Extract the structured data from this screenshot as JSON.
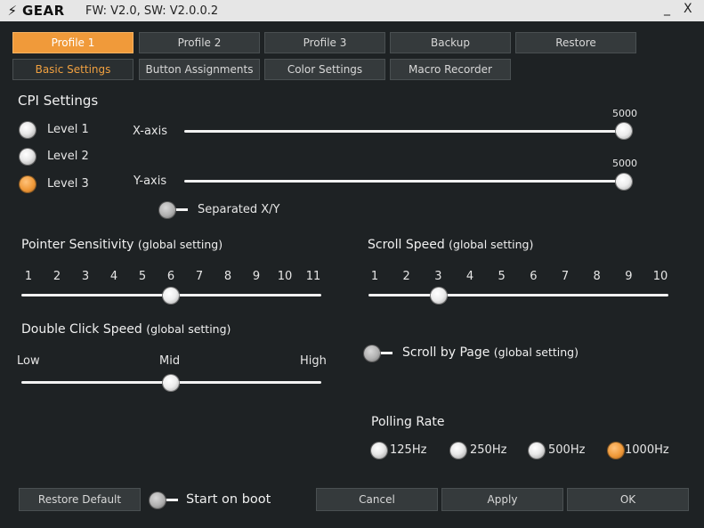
{
  "window": {
    "logo_text": "GEAR",
    "version": "FW: V2.0, SW: V2.0.0.2",
    "minimize": "_",
    "close": "X"
  },
  "profile_tabs": [
    "Profile 1",
    "Profile 2",
    "Profile 3",
    "Backup",
    "Restore"
  ],
  "sub_tabs": [
    "Basic Settings",
    "Button Assignments",
    "Color Settings",
    "Macro Recorder"
  ],
  "cpi": {
    "title": "CPI Settings",
    "levels": [
      "Level 1",
      "Level 2",
      "Level 3"
    ],
    "selected_level": "Level 3",
    "x_label": "X-axis",
    "x_value": "5000",
    "y_label": "Y-axis",
    "y_value": "5000",
    "separated_label": "Separated X/Y"
  },
  "pointer": {
    "title": "Pointer Sensitivity",
    "suffix": "(global setting)",
    "ticks": [
      "1",
      "2",
      "3",
      "4",
      "5",
      "6",
      "7",
      "8",
      "9",
      "10",
      "11"
    ],
    "value": 6
  },
  "scroll_speed": {
    "title": "Scroll Speed",
    "suffix": "(global setting)",
    "ticks": [
      "1",
      "2",
      "3",
      "4",
      "5",
      "6",
      "7",
      "8",
      "9",
      "10"
    ],
    "value": 3
  },
  "double_click": {
    "title": "Double Click Speed",
    "suffix": "(global setting)",
    "low": "Low",
    "mid": "Mid",
    "high": "High"
  },
  "scroll_by_page": {
    "label": "Scroll by Page",
    "suffix": "(global setting)"
  },
  "polling": {
    "title": "Polling Rate",
    "options": [
      "125Hz",
      "250Hz",
      "500Hz",
      "1000Hz"
    ],
    "selected": "1000Hz"
  },
  "footer": {
    "restore_default": "Restore Default",
    "start_on_boot": "Start on boot",
    "cancel": "Cancel",
    "apply": "Apply",
    "ok": "OK"
  },
  "colors": {
    "accent": "#f09a3a",
    "background": "#1e2224",
    "titlebar": "#e6e6e6"
  }
}
